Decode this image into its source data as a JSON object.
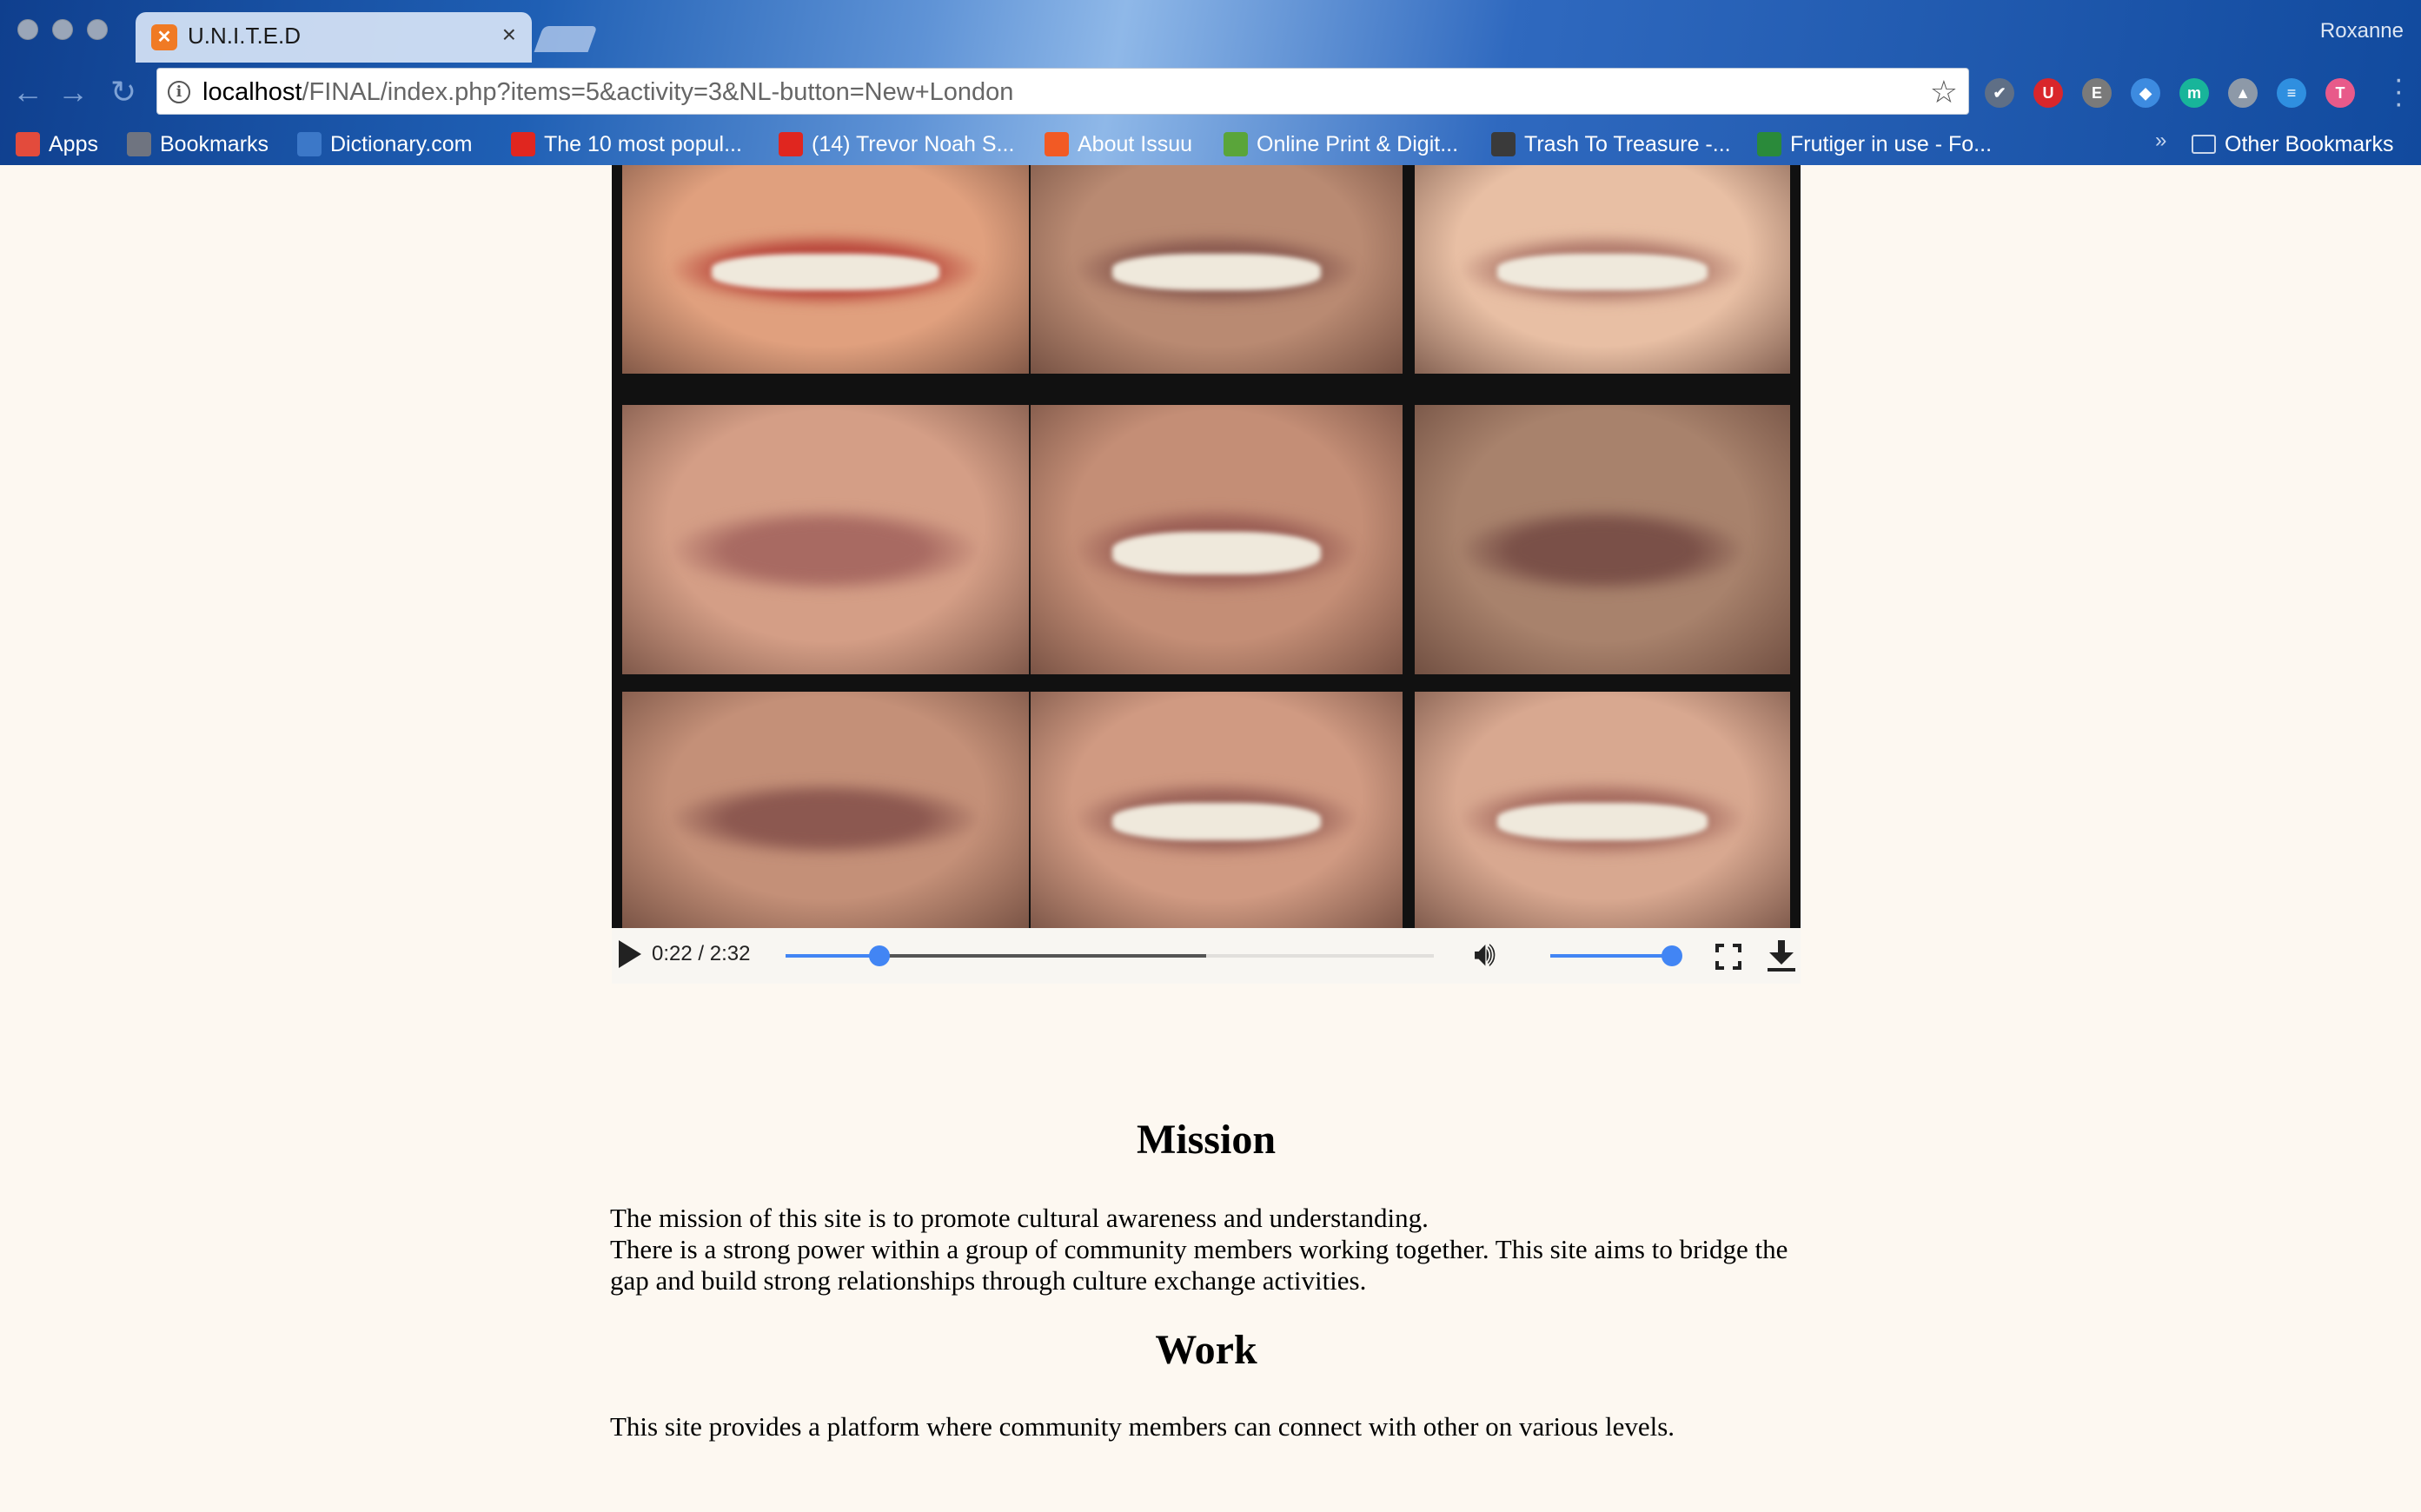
{
  "browser": {
    "tab_title": "U.N.I.T.E.D",
    "tab_close": "×",
    "profile_name": "Roxanne",
    "url_host": "localhost",
    "url_path": "/FINAL/index.php?items=5&activity=3&NL-button=New+London",
    "extensions": [
      {
        "name": "pocket-icon",
        "color": "#5f6f86",
        "glyph": "✔"
      },
      {
        "name": "ublock-icon",
        "color": "#d9262b",
        "glyph": "U"
      },
      {
        "name": "evernote-icon",
        "color": "#7a7a7a",
        "glyph": "E"
      },
      {
        "name": "dropbox-icon",
        "color": "#3d8be0",
        "glyph": "◆"
      },
      {
        "name": "mendeley-icon",
        "color": "#18b59a",
        "glyph": "m"
      },
      {
        "name": "drive-icon",
        "color": "#8d99a8",
        "glyph": "▲"
      },
      {
        "name": "stacks-icon",
        "color": "#2f8fe0",
        "glyph": "≡"
      },
      {
        "name": "avatar-ext-icon",
        "color": "#e85a8a",
        "glyph": "T"
      }
    ],
    "bookmarks": [
      {
        "label": "Apps",
        "icon": "apps-grid-icon",
        "color": "#e34b3c"
      },
      {
        "label": "Bookmarks",
        "icon": "star-icon",
        "color": "#6f7480"
      },
      {
        "label": "Dictionary.com",
        "icon": "dictionary-icon",
        "color": "#3c78c8"
      },
      {
        "label": "The 10 most popul...",
        "icon": "t-logo-icon",
        "color": "#e0261f"
      },
      {
        "label": "(14) Trevor Noah S...",
        "icon": "youtube-icon",
        "color": "#e0261f"
      },
      {
        "label": "About Issuu",
        "icon": "issuu-icon",
        "color": "#f25a24"
      },
      {
        "label": "Online Print & Digit...",
        "icon": "print-icon",
        "color": "#5aa53a"
      },
      {
        "label": "Trash To Treasure -...",
        "icon": "trash-site-icon",
        "color": "#3a3a3a"
      },
      {
        "label": "Frutiger in use - Fo...",
        "icon": "fonts-in-use-icon",
        "color": "#2a8a3a"
      }
    ],
    "bookmarks_overflow": "»",
    "other_bookmarks": "Other Bookmarks"
  },
  "video": {
    "current_time": "0:22",
    "duration": "2:32",
    "time_label": "0:22 / 2:32",
    "progress_fraction": 0.145,
    "volume_fraction": 1.0
  },
  "sections": [
    {
      "heading": "Mission",
      "lines": [
        "The mission of this site is to promote cultural awareness and understanding.",
        "There is a strong power within a group of community members working together. This site aims to bridge the gap and build strong relationships through culture exchange activities."
      ]
    },
    {
      "heading": "Work",
      "lines": [
        "This site provides a platform where community members can connect with other on various levels."
      ]
    }
  ]
}
